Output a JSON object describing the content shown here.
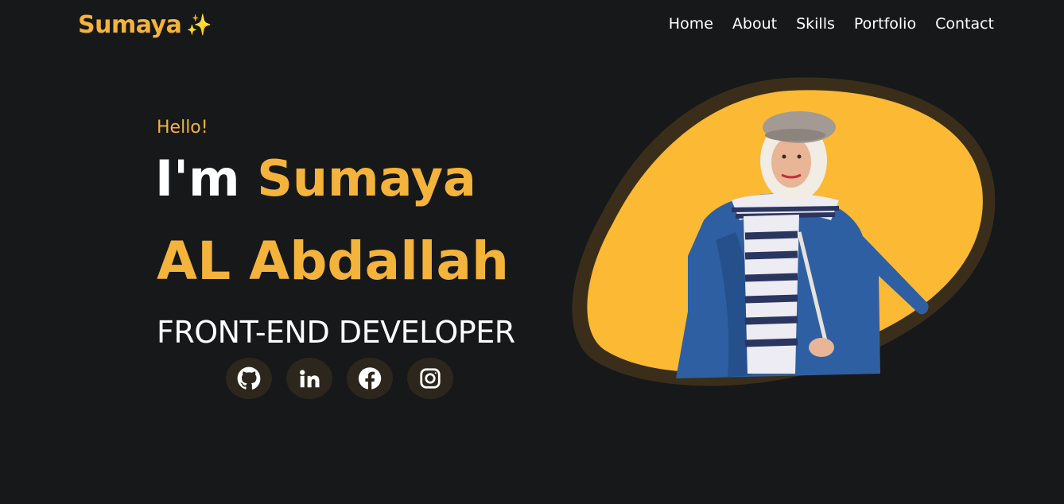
{
  "header": {
    "logo": "Sumaya",
    "logo_icon": "sparkles-icon",
    "nav": [
      "Home",
      "About",
      "Skills",
      "Portfolio",
      "Contact"
    ]
  },
  "hero": {
    "greeting": "Hello!",
    "im": "I'm",
    "first_name": "Sumaya",
    "last_name": "AL Abdallah",
    "role": "FRONT-END DEVELOPER"
  },
  "socials": [
    {
      "name": "github-icon"
    },
    {
      "name": "linkedin-icon"
    },
    {
      "name": "facebook-icon"
    },
    {
      "name": "instagram-icon"
    }
  ],
  "portrait": {
    "description_icon": "portrait-photo",
    "blob_color": "#fbb934",
    "ring_color": "#3a2e1b"
  },
  "colors": {
    "background": "#17181a",
    "accent": "#f4b33a",
    "text": "#ffffff"
  }
}
